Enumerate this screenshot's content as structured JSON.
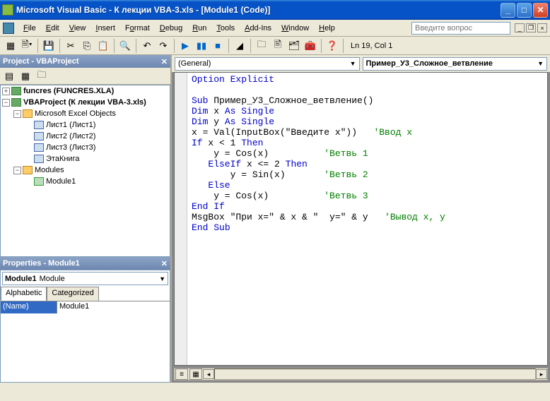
{
  "titlebar": {
    "title": "Microsoft Visual Basic - К лекции VBA-3.xls - [Module1 (Code)]"
  },
  "menu": {
    "file": "File",
    "edit": "Edit",
    "view": "View",
    "insert": "Insert",
    "format": "Format",
    "debug": "Debug",
    "run": "Run",
    "tools": "Tools",
    "addins": "Add-Ins",
    "window": "Window",
    "help": "Help",
    "helpbox_placeholder": "Введите вопрос"
  },
  "status": {
    "cursor": "Ln 19, Col 1"
  },
  "project_pane": {
    "title": "Project - VBAProject",
    "tree": {
      "funcres": "funcres (FUNCRES.XLA)",
      "vbaproj": "VBAProject (К лекции VBA-3.xls)",
      "excel_objects": "Microsoft Excel Objects",
      "sheet1": "Лист1 (Лист1)",
      "sheet2": "Лист2 (Лист2)",
      "sheet3": "Лист3 (Лист3)",
      "thisworkbook": "ЭтаКнига",
      "modules_folder": "Modules",
      "module1": "Module1"
    }
  },
  "props_pane": {
    "title": "Properties - Module1",
    "object_name": "Module1",
    "object_type": "Module",
    "tab_alpha": "Alphabetic",
    "tab_cat": "Categorized",
    "rows": {
      "name_label": "(Name)",
      "name_value": "Module1"
    }
  },
  "code_pane": {
    "left_combo": "(General)",
    "right_combo": "Пример_У3_Сложное_ветвление",
    "lines": [
      {
        "t": "Option Explicit",
        "kw": [
          "Option",
          "Explicit"
        ]
      },
      {
        "t": ""
      },
      {
        "t": "Sub Пример_У3_Сложное_ветвление()",
        "kw": [
          "Sub"
        ]
      },
      {
        "t": "Dim x As Single",
        "kw": [
          "Dim",
          "As",
          "Single"
        ]
      },
      {
        "t": "Dim y As Single",
        "kw": [
          "Dim",
          "As",
          "Single"
        ]
      },
      {
        "t": "x = Val(InputBox(\"Введите x\"))   'Ввод x",
        "cm": "'Ввод x"
      },
      {
        "t": "If x < 1 Then",
        "kw": [
          "If",
          "Then"
        ]
      },
      {
        "t": "    y = Cos(x)          'Ветвь 1",
        "cm": "'Ветвь 1"
      },
      {
        "t": "   ElseIf x <= 2 Then",
        "kw": [
          "ElseIf",
          "Then"
        ]
      },
      {
        "t": "       y = Sin(x)       'Ветвь 2",
        "cm": "'Ветвь 2"
      },
      {
        "t": "   Else",
        "kw": [
          "Else"
        ]
      },
      {
        "t": "    y = Cos(x)          'Ветвь 3",
        "cm": "'Ветвь 3"
      },
      {
        "t": "End If",
        "kw": [
          "End",
          "If"
        ]
      },
      {
        "t": "MsgBox \"При x=\" & x & \"  y=\" & y   'Вывод x, y",
        "cm": "'Вывод x, y"
      },
      {
        "t": "End Sub",
        "kw": [
          "End",
          "Sub"
        ]
      }
    ]
  }
}
